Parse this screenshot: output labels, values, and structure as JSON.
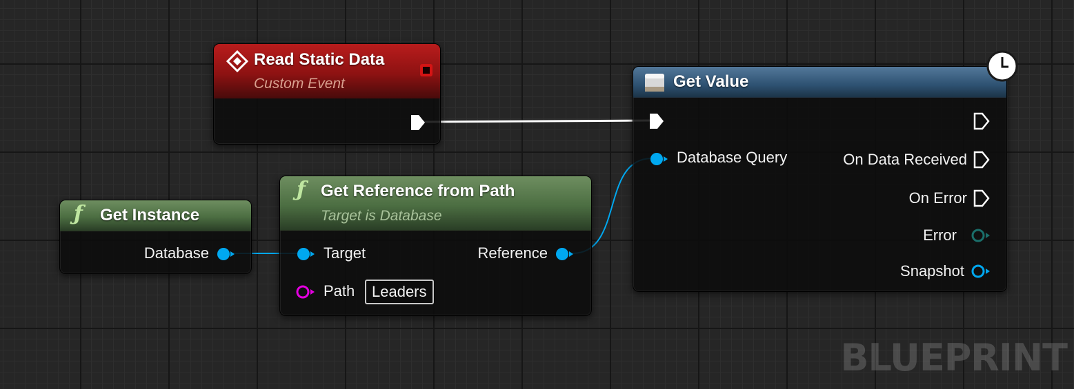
{
  "nodes": {
    "read_static_data": {
      "title": "Read Static Data",
      "subtitle": "Custom Event"
    },
    "get_value": {
      "title": "Get Value",
      "pins": {
        "database_query": "Database Query",
        "on_data_received": "On Data Received",
        "on_error": "On Error",
        "error": "Error",
        "snapshot": "Snapshot"
      }
    },
    "get_instance": {
      "title": "Get Instance",
      "pins": {
        "database": "Database"
      }
    },
    "get_reference_from_path": {
      "title": "Get Reference from Path",
      "subtitle": "Target is Database",
      "pins": {
        "target": "Target",
        "reference": "Reference",
        "path": "Path",
        "path_value": "Leaders"
      }
    }
  },
  "watermark": "BLUEPRINT",
  "icons": {
    "event": "event-diamond-icon",
    "function": "function-f-icon",
    "latent": "clock-icon",
    "async": "async-node-icon"
  },
  "colors": {
    "exec": "#ffffff",
    "object_pin": "#00a8f0",
    "string_pin": "#e400e0",
    "error_pin": "#1a6e6a",
    "event_header": "#8e1212",
    "function_header": "#4c6e42",
    "async_header": "#2e5272"
  }
}
